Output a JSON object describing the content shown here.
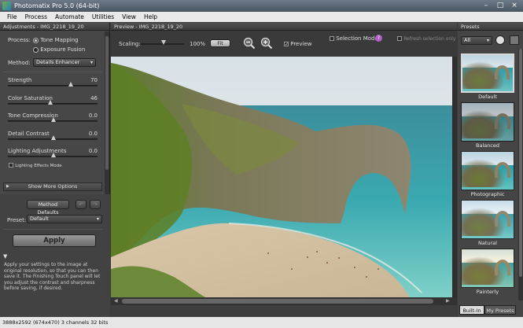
{
  "window": {
    "title": "Photomatix Pro 5.0 (64-bit)",
    "controls": [
      "–",
      "□",
      "×"
    ]
  },
  "menu": [
    "File",
    "Process",
    "Automate",
    "Utilities",
    "View",
    "Help"
  ],
  "adjustments": {
    "header": "Adjustments - IMG_2218_19_20",
    "process_label": "Process:",
    "process_options": [
      "Tone Mapping",
      "Exposure Fusion"
    ],
    "method_label": "Method:",
    "method_value": "Details Enhancer",
    "sliders": [
      {
        "label": "Strength",
        "value": "70",
        "fraction": 0.7
      },
      {
        "label": "Color Saturation",
        "value": "46",
        "fraction": 0.46
      },
      {
        "label": "Tone Compression",
        "value": "0.0",
        "fraction": 0.5
      },
      {
        "label": "Detail Contrast",
        "value": "0.0",
        "fraction": 0.5
      },
      {
        "label": "Lighting Adjustments",
        "value": "0.0",
        "fraction": 0.5
      }
    ],
    "lighting_effects_label": "Lighting Effects Mode",
    "show_more_label": "Show More Options",
    "method_defaults_label": "Method Defaults",
    "undo_icon": "undo-icon",
    "redo_icon": "redo-icon",
    "preset_label": "Preset:",
    "preset_value": "Default",
    "apply_label": "Apply",
    "help_text": "Apply your settings to the image at original resolution, so that you can then save it. The Finishing Touch panel will let you adjust the contrast and sharpness before saving, if desired."
  },
  "preview": {
    "header": "Preview - IMG_2218_19_20",
    "scaling_label": "Scaling:",
    "scaling_value": "100%",
    "fit_label": "Fit",
    "zoom_in_icon": "zoom-in-icon",
    "zoom_out_icon": "zoom-out-icon",
    "preview_check_label": "Preview",
    "selection_mode_label": "Selection Mode",
    "selective_label": "Refresh selection only"
  },
  "presets": {
    "header": "Presets",
    "filter_value": "All",
    "items": [
      "Default",
      "Balanced",
      "Photographic",
      "Natural",
      "Painterly"
    ],
    "tabs": [
      "Built-In",
      "My Presets"
    ]
  },
  "status": {
    "text": "3888x2592 (674x470) 3 channels 32 bits"
  },
  "colors": {
    "panel_bg": "#474747",
    "menu_bg": "#e9e9e9",
    "title_bg": "#5a6572",
    "selected_preset": "#d8d8d8"
  }
}
